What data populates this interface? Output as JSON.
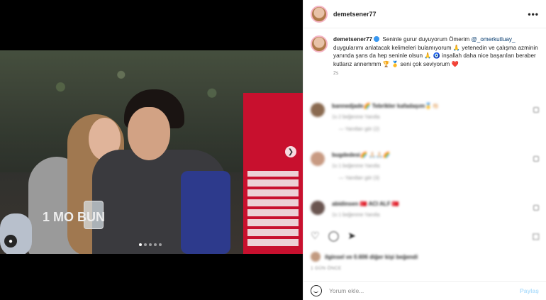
{
  "post": {
    "username": "demetsener77",
    "more_label": "•••",
    "carousel": {
      "active_index": 0,
      "count": 5
    },
    "jersey_text": "1 MO BUN"
  },
  "caption": {
    "username": "demetsener77",
    "text_before_mention": " Seninle gurur duyuyorum Ömerim ",
    "mention": "@_omerkutluay_",
    "text_after_mention": " duygularımı anlatacak kelimeleri bulamıyorum 🙏 yetenedin ve çalışma azminin yanında şans da hep seninle olsun 🙏 🧿 inşallah daha nice başarıları beraber kutlarız annemmm 🏆 🥇 seni çok seviyorum",
    "heart": "❤️",
    "time": "2s"
  },
  "comments": [
    {
      "line": "bannedjade🌈 Tebrikler kafadaşım🥇👏🏻",
      "meta": "1s   2 beğenme   Yanıtla",
      "replies": "— Yanıtları gör (2)"
    },
    {
      "line": "bugdedesi🌈 🙏🏻🙏🏻🌈",
      "meta": "1s   1 beğenme   Yanıtla",
      "replies": "— Yanıtları gör (3)"
    },
    {
      "line": "abidinsen 🇹🇷 ACI ALF 🇹🇷",
      "meta": "1s   1 beğenme   Yanıtla",
      "replies": ""
    }
  ],
  "likes_text": "ilginsel ve 0.606 diğer kişi beğendi",
  "date_text": "1 GÜN ÖNCE",
  "add_comment": {
    "placeholder": "Yorum ekle...",
    "post_label": "Paylaş"
  },
  "icons": {
    "more": "more-horiz-icon",
    "next": "chevron-right-icon",
    "user_tag": "user-icon",
    "like": "heart-icon",
    "comment": "comment-icon",
    "share": "paper-plane-icon",
    "save": "bookmark-icon",
    "emoji": "smile-icon"
  },
  "colors": {
    "brand_banner": "#c8102e",
    "link": "#00376b",
    "verified": "#3897f0",
    "post_disabled": "#b2dffc"
  }
}
